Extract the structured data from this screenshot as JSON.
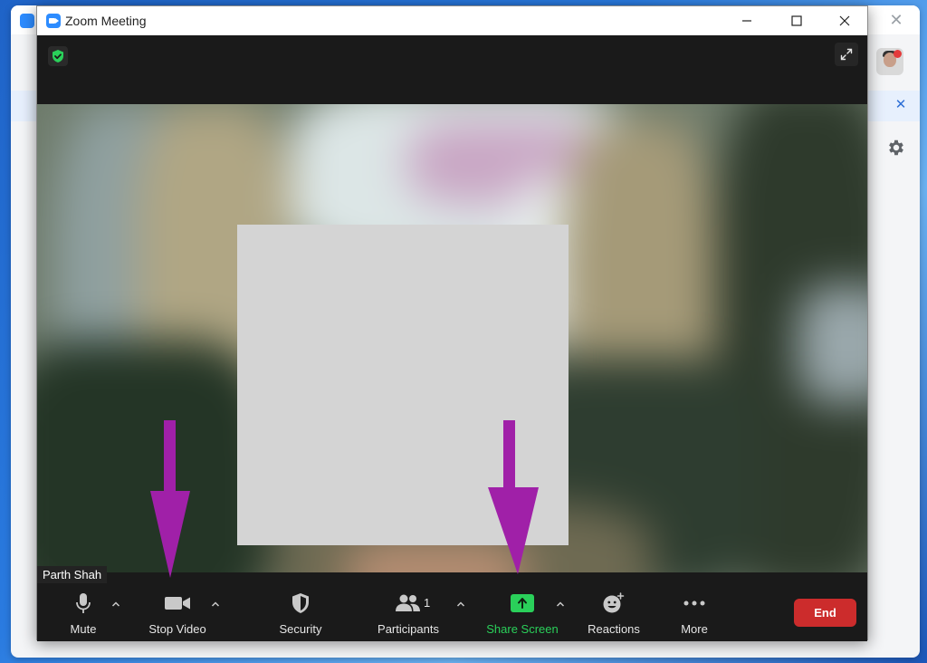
{
  "window": {
    "title": "Zoom Meeting"
  },
  "video": {
    "participant_name": "Parth Shah"
  },
  "toolbar": {
    "mute_label": "Mute",
    "stop_video_label": "Stop Video",
    "security_label": "Security",
    "participants_label": "Participants",
    "participants_count": "1",
    "share_screen_label": "Share Screen",
    "reactions_label": "Reactions",
    "more_label": "More",
    "end_label": "End"
  },
  "icons": {
    "security_shield": "shield-check-icon",
    "fullscreen": "expand-icon",
    "mute": "microphone-icon",
    "video": "video-camera-icon",
    "security": "shield-icon",
    "participants": "people-icon",
    "share": "share-screen-icon",
    "reactions": "smiley-plus-icon",
    "more": "ellipsis-icon"
  },
  "colors": {
    "toolbar_bg": "#1a1a1a",
    "share_green": "#2ad05a",
    "end_red": "#cc2c2c",
    "annotation_arrow": "#a020a8",
    "zoom_blue": "#2d8cff"
  }
}
